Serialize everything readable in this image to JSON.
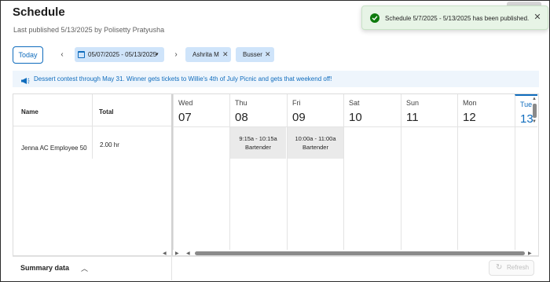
{
  "page": {
    "title": "Schedule",
    "subtitle": "Last published 5/13/2025 by Polisetty Pratyusha"
  },
  "toast": {
    "message": "Schedule 5/7/2025 - 5/13/2025 has been published.",
    "close_glyph": "✕",
    "icon": "check-circle-icon"
  },
  "toolbar": {
    "today_label": "Today",
    "prev_glyph": "‹",
    "next_glyph": "›",
    "date_range": "05/07/2025 - 05/13/2025",
    "date_dropdown_glyph": "▾",
    "filters": [
      {
        "label": "Ashrita M",
        "remove_glyph": "✕"
      },
      {
        "label": "Busser",
        "remove_glyph": "✕"
      }
    ]
  },
  "announcement": {
    "text": "Dessert contest through May 31. Winner gets tickets to Willie's 4th of July Picnic and gets that weekend off!",
    "icon": "megaphone-icon"
  },
  "grid": {
    "headers": {
      "name": "Name",
      "total": "Total"
    },
    "days": [
      {
        "name": "Wed",
        "num": "07"
      },
      {
        "name": "Thu",
        "num": "08"
      },
      {
        "name": "Fri",
        "num": "09"
      },
      {
        "name": "Sat",
        "num": "10"
      },
      {
        "name": "Sun",
        "num": "11"
      },
      {
        "name": "Mon",
        "num": "12"
      },
      {
        "name": "Tue",
        "num": "13"
      }
    ],
    "rows": [
      {
        "employee": "Jenna AC Employee 50",
        "total": "2.00 hr",
        "shifts": [
          {
            "day": "Thu",
            "time": "9:15a - 10:15a",
            "role": "Bartender"
          },
          {
            "day": "Fri",
            "time": "10:00a - 11:00a",
            "role": "Bartender"
          }
        ]
      }
    ]
  },
  "footer": {
    "summary_label": "Summary data",
    "chevron_glyph": "︿",
    "refresh_label": "Refresh",
    "refresh_glyph": "↻"
  },
  "colors": {
    "accent": "#0f6cbd",
    "chip_bg": "#cfe4fa",
    "toast_bg": "#e7f4e6",
    "success": "#0e7a0d",
    "shift_bg": "#eaeaea"
  }
}
